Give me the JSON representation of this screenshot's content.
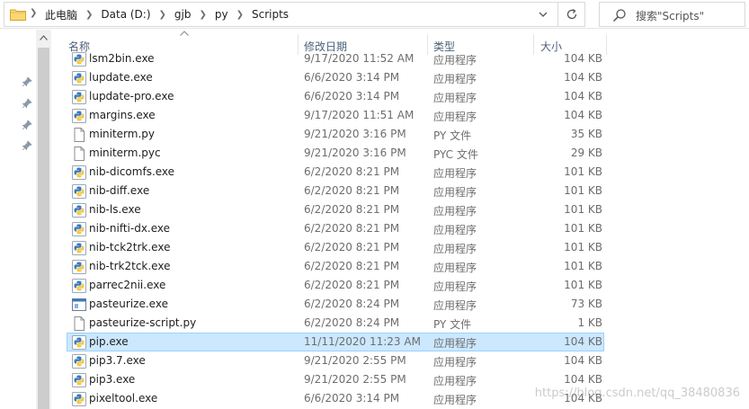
{
  "address_bar": {
    "breadcrumbs": [
      "此电脑",
      "Data (D:)",
      "gjb",
      "py",
      "Scripts"
    ]
  },
  "search": {
    "placeholder": "搜索\"Scripts\""
  },
  "columns": {
    "name": "名称",
    "date": "修改日期",
    "type": "类型",
    "size": "大小"
  },
  "files": [
    {
      "name": "lsm2bin.exe",
      "date": "9/17/2020 11:52 AM",
      "type": "应用程序",
      "size": "104 KB",
      "icon": "python-exe-icon"
    },
    {
      "name": "lupdate.exe",
      "date": "6/6/2020 3:14 PM",
      "type": "应用程序",
      "size": "104 KB",
      "icon": "python-exe-icon"
    },
    {
      "name": "lupdate-pro.exe",
      "date": "6/6/2020 3:14 PM",
      "type": "应用程序",
      "size": "104 KB",
      "icon": "python-exe-icon"
    },
    {
      "name": "margins.exe",
      "date": "9/17/2020 11:51 AM",
      "type": "应用程序",
      "size": "104 KB",
      "icon": "python-exe-icon"
    },
    {
      "name": "miniterm.py",
      "date": "9/21/2020 3:16 PM",
      "type": "PY 文件",
      "size": "35 KB",
      "icon": "document-file-icon"
    },
    {
      "name": "miniterm.pyc",
      "date": "9/21/2020 3:16 PM",
      "type": "PYC 文件",
      "size": "29 KB",
      "icon": "document-file-icon"
    },
    {
      "name": "nib-dicomfs.exe",
      "date": "6/2/2020 8:21 PM",
      "type": "应用程序",
      "size": "101 KB",
      "icon": "python-exe-icon"
    },
    {
      "name": "nib-diff.exe",
      "date": "6/2/2020 8:21 PM",
      "type": "应用程序",
      "size": "101 KB",
      "icon": "python-exe-icon"
    },
    {
      "name": "nib-ls.exe",
      "date": "6/2/2020 8:21 PM",
      "type": "应用程序",
      "size": "101 KB",
      "icon": "python-exe-icon"
    },
    {
      "name": "nib-nifti-dx.exe",
      "date": "6/2/2020 8:21 PM",
      "type": "应用程序",
      "size": "101 KB",
      "icon": "python-exe-icon"
    },
    {
      "name": "nib-tck2trk.exe",
      "date": "6/2/2020 8:21 PM",
      "type": "应用程序",
      "size": "101 KB",
      "icon": "python-exe-icon"
    },
    {
      "name": "nib-trk2tck.exe",
      "date": "6/2/2020 8:21 PM",
      "type": "应用程序",
      "size": "101 KB",
      "icon": "python-exe-icon"
    },
    {
      "name": "parrec2nii.exe",
      "date": "6/2/2020 8:21 PM",
      "type": "应用程序",
      "size": "101 KB",
      "icon": "python-exe-icon"
    },
    {
      "name": "pasteurize.exe",
      "date": "6/2/2020 8:24 PM",
      "type": "应用程序",
      "size": "73 KB",
      "icon": "application-window-icon"
    },
    {
      "name": "pasteurize-script.py",
      "date": "6/2/2020 8:24 PM",
      "type": "PY 文件",
      "size": "1 KB",
      "icon": "document-file-icon"
    },
    {
      "name": "pip.exe",
      "date": "11/11/2020 11:23 AM",
      "type": "应用程序",
      "size": "104 KB",
      "icon": "python-exe-icon",
      "selected": true
    },
    {
      "name": "pip3.7.exe",
      "date": "9/21/2020 2:55 PM",
      "type": "应用程序",
      "size": "104 KB",
      "icon": "python-exe-icon"
    },
    {
      "name": "pip3.exe",
      "date": "9/21/2020 2:55 PM",
      "type": "应用程序",
      "size": "104 KB",
      "icon": "python-exe-icon"
    },
    {
      "name": "pixeltool.exe",
      "date": "6/6/2020 3:14 PM",
      "type": "应用程序",
      "size": "104 KB",
      "icon": "python-exe-icon"
    }
  ],
  "watermark": "https://blog.csdn.net/qq_38480836",
  "colors": {
    "selection_bg": "#cce8ff",
    "selection_border": "#99d1ff",
    "header_text": "#4c607a",
    "muted_text": "#6d6d6d"
  }
}
